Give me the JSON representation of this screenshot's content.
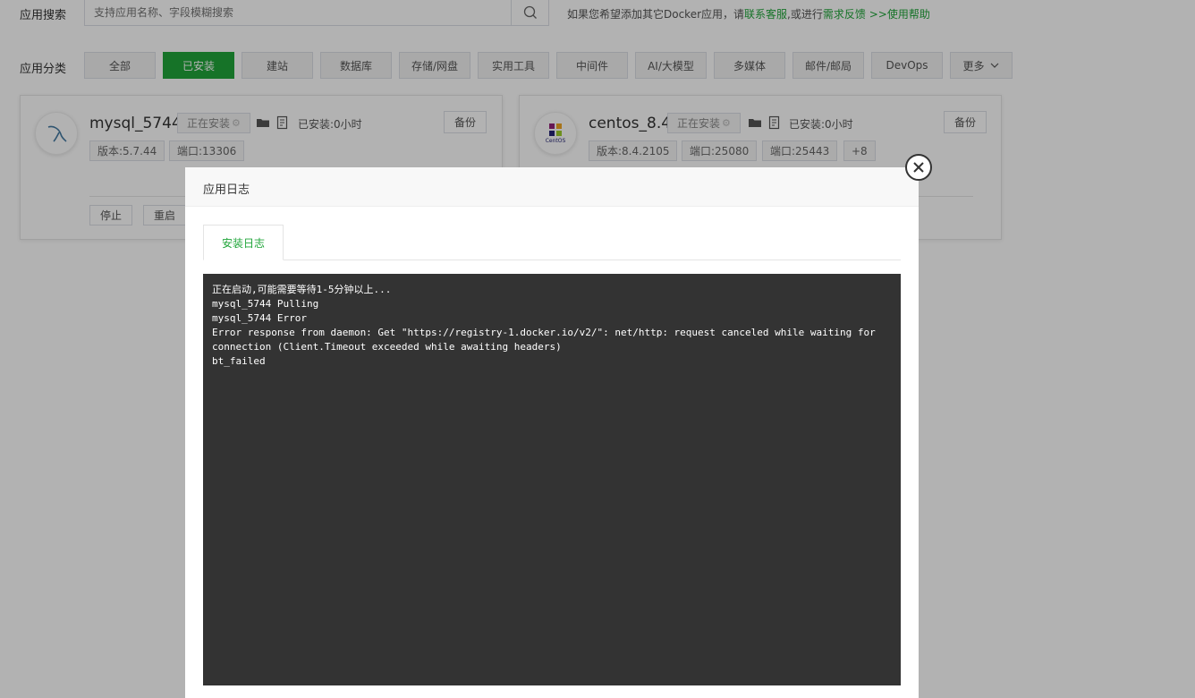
{
  "search": {
    "label": "应用搜索",
    "placeholder": "支持应用名称、字段模糊搜索",
    "hint_prefix": "如果您希望添加其它Docker应用，请",
    "hint_link1": "联系客服",
    "hint_mid": ",或进行",
    "hint_link2": "需求反馈",
    "hint_arrows": " >>",
    "hint_link3": "使用帮助"
  },
  "categories": {
    "label": "应用分类",
    "items": [
      "全部",
      "已安装",
      "建站",
      "数据库",
      "存储/网盘",
      "实用工具",
      "中间件",
      "AI/大模型",
      "多媒体",
      "邮件/邮局",
      "DevOps"
    ],
    "active": "已安装",
    "more": "更多"
  },
  "cards": [
    {
      "name": "mysql_5744",
      "status": "正在安装",
      "installed": "已安装:0小时",
      "backup": "备份",
      "tags": [
        "版本:5.7.44",
        "端口:13306"
      ],
      "actions": [
        "停止",
        "重启"
      ],
      "icon": "mysql-logo-icon"
    },
    {
      "name": "centos_8.4",
      "status": "正在安装",
      "installed": "已安装:0小时",
      "backup": "备份",
      "tags": [
        "版本:8.4.2105",
        "端口:25080",
        "端口:25443",
        "+8"
      ],
      "icon": "centos-logo-icon",
      "logo_text": "CentOS"
    }
  ],
  "dialog": {
    "title": "应用日志",
    "tab": "安装日志",
    "log_lines": [
      "正在启动,可能需要等待1-5分钟以上...",
      "mysql_5744 Pulling",
      "mysql_5744 Error",
      "Error response from daemon: Get \"https://registry-1.docker.io/v2/\": net/http: request canceled while waiting for connection (Client.Timeout exceeded while awaiting headers)",
      "bt_failed"
    ]
  },
  "colors": {
    "accent": "#20a53a",
    "log_bg": "#333333"
  }
}
